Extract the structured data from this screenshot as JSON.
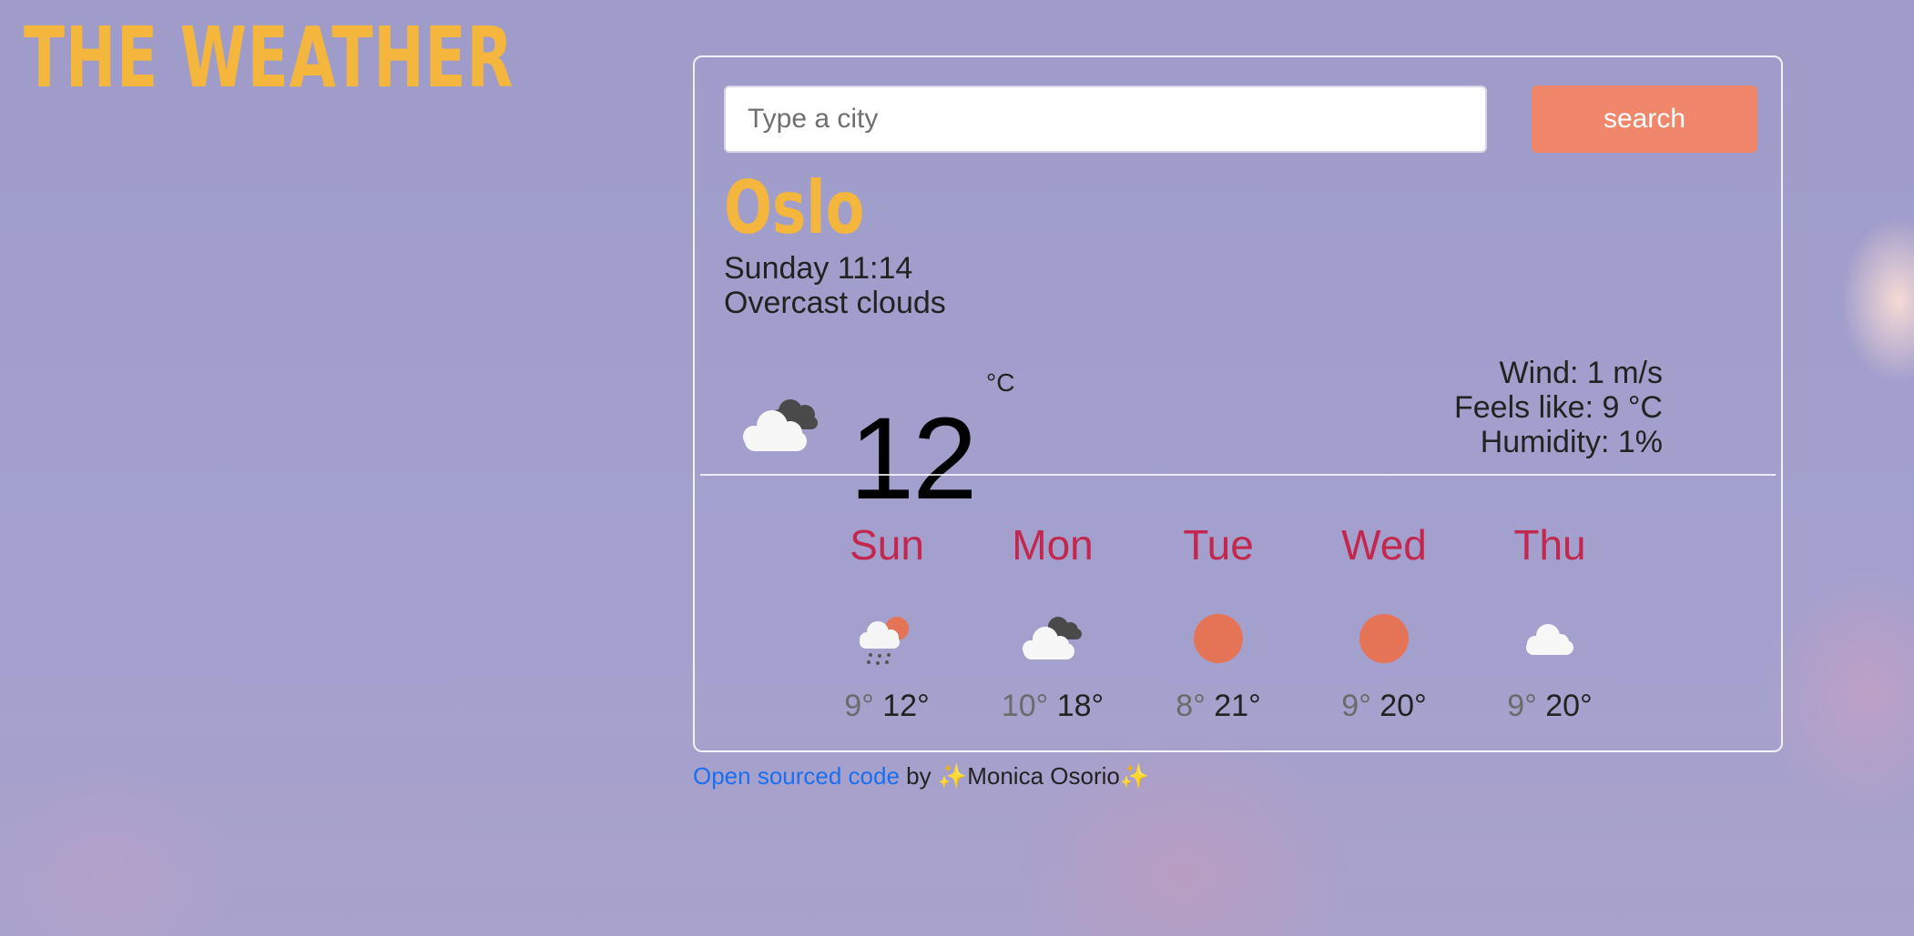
{
  "brand": {
    "title": "THE WEATHER"
  },
  "search": {
    "placeholder": "Type a city",
    "value": "",
    "button_label": "search"
  },
  "current": {
    "city": "Oslo",
    "datetime": "Sunday 11:14",
    "description": "Overcast clouds",
    "temperature": "12",
    "unit": "°C",
    "icon": "broken-clouds-icon",
    "wind": "Wind: 1 m/s",
    "feels_like": "Feels like: 9 °C",
    "humidity": "Humidity: 1%"
  },
  "forecast": [
    {
      "day": "Sun",
      "icon": "rain-sun-icon",
      "min": "9°",
      "max": "12°"
    },
    {
      "day": "Mon",
      "icon": "broken-clouds-icon",
      "min": "10°",
      "max": "18°"
    },
    {
      "day": "Tue",
      "icon": "sun-icon",
      "min": "8°",
      "max": "21°"
    },
    {
      "day": "Wed",
      "icon": "sun-icon",
      "min": "9°",
      "max": "20°"
    },
    {
      "day": "Thu",
      "icon": "cloud-icon",
      "min": "9°",
      "max": "20°"
    }
  ],
  "footer": {
    "link_text": "Open sourced code",
    "by_text": " by ✨Monica Osorio✨"
  },
  "colors": {
    "accent": "#f4b63c",
    "button": "#f0876b",
    "day": "#c3274e",
    "link": "#1a6ef0",
    "sun": "#e57457"
  }
}
